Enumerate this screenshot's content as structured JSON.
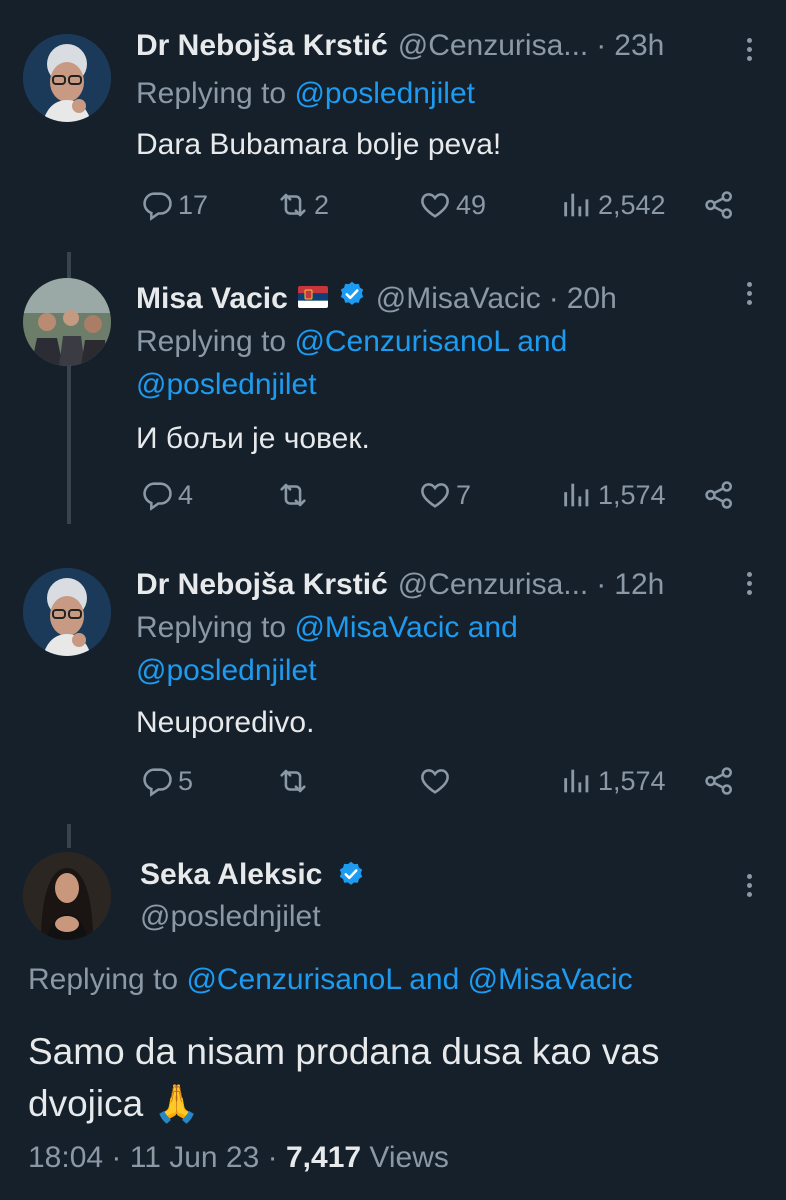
{
  "tweets": [
    {
      "name": "Dr Nebojša Krstić",
      "handle": "@Cenzurisa...",
      "time": "23h",
      "replying_prefix": "Replying to",
      "replying_to_1": "@poslednjilet",
      "replying_joiner": "",
      "replying_to_2": "",
      "text": "Dara Bubamara bolje peva!",
      "replies": "17",
      "retweets": "2",
      "likes": "49",
      "views": "2,542"
    },
    {
      "name": "Misa Vacic",
      "flag": "serbian-flag",
      "verified": true,
      "handle": "@MisaVacic",
      "time": "20h",
      "replying_prefix": "Replying to",
      "replying_to_1": "@CenzurisanoL and",
      "replying_joiner": "",
      "replying_to_2": "@poslednjilet",
      "text": "И бољи је човек.",
      "replies": "4",
      "retweets": "",
      "likes": "7",
      "views": "1,574"
    },
    {
      "name": "Dr Nebojša Krstić",
      "handle": "@Cenzurisa...",
      "time": "12h",
      "replying_prefix": "Replying to",
      "replying_to_1": "@MisaVacic and",
      "replying_joiner": "",
      "replying_to_2": "@poslednjilet",
      "text": "Neuporedivo.",
      "replies": "5",
      "retweets": "",
      "likes": "",
      "views": "1,574"
    }
  ],
  "main": {
    "name": "Seka Aleksic",
    "verified": true,
    "handle": "@poslednjilet",
    "replying_prefix": "Replying to",
    "replying_to_1": "@CenzurisanoL",
    "replying_and": "and",
    "replying_to_2": "@MisaVacic",
    "text": "Samo da nisam prodana dusa kao vas dvojica 🙏",
    "time": "18:04",
    "date": "11 Jun 23",
    "views_count": "7,417",
    "views_label": "Views"
  },
  "colors": {
    "background": "#15202b",
    "link": "#1d9bf0",
    "muted": "#8b98a5",
    "text": "#e7e9ea"
  }
}
